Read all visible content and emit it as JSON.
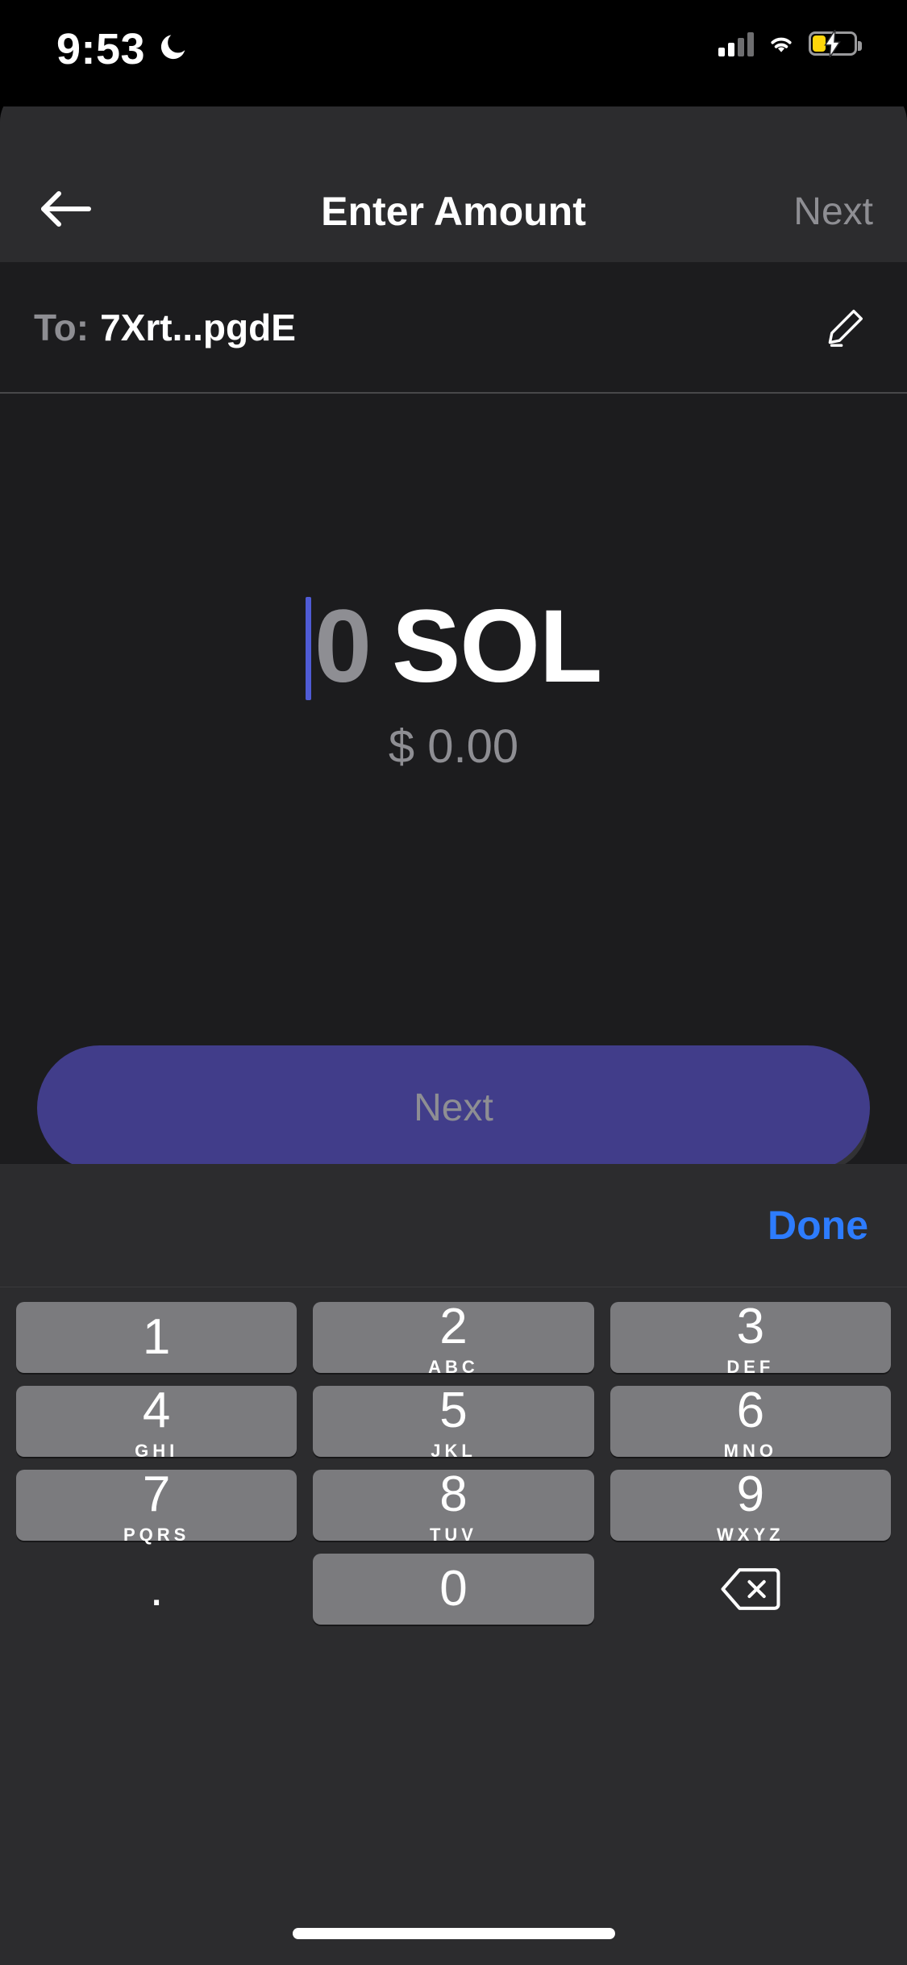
{
  "status_bar": {
    "time": "9:53",
    "dnd_icon": "moon-icon",
    "cellular_icon": "cellular-signal-icon",
    "wifi_icon": "wifi-icon",
    "battery_icon": "battery-charging-icon"
  },
  "header": {
    "back_icon": "back-arrow-icon",
    "title": "Enter Amount",
    "action_label": "Next",
    "action_color": "#8e8e93"
  },
  "recipient": {
    "label": "To:",
    "address": "7Xrt...pgdE",
    "edit_icon": "pencil-edit-icon"
  },
  "amount": {
    "value": "0",
    "symbol": "SOL",
    "fiat": "$ 0.00",
    "caret_color": "#4f5bd5",
    "swap_icon": "swap-vertical-icon"
  },
  "cta": {
    "label": "Next",
    "background": "#413d8a",
    "text_color": "#8e8e93"
  },
  "keyboard": {
    "accessory": {
      "done_label": "Done",
      "done_color": "#2d7cfe"
    },
    "key_color": "#7b7b7e",
    "rows": [
      [
        {
          "digit": "1",
          "letters": ""
        },
        {
          "digit": "2",
          "letters": "ABC"
        },
        {
          "digit": "3",
          "letters": "DEF"
        }
      ],
      [
        {
          "digit": "4",
          "letters": "GHI"
        },
        {
          "digit": "5",
          "letters": "JKL"
        },
        {
          "digit": "6",
          "letters": "MNO"
        }
      ],
      [
        {
          "digit": "7",
          "letters": "PQRS"
        },
        {
          "digit": "8",
          "letters": "TUV"
        },
        {
          "digit": "9",
          "letters": "WXYZ"
        }
      ]
    ],
    "bottom_row": {
      "decimal": ".",
      "zero": "0",
      "backspace_icon": "backspace-delete-icon"
    }
  },
  "home_indicator": "home-indicator"
}
